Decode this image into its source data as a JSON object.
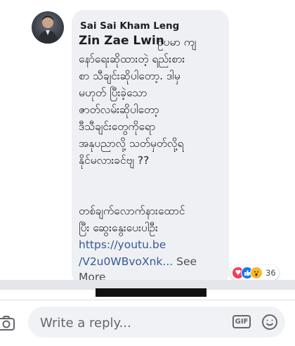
{
  "comment": {
    "author": "Sai Sai Kham Leng",
    "mention": "Zin Zae Lwin",
    "body_lines": [
      "ဥပမာ ကျ",
      "နော်ရေးဆိုထားတဲ့ ရည်းစား",
      "စာ သီချင်းဆိုပါတော့. ဒါမှ",
      "မဟုတ် ပြီးခဲ့သော",
      "ဇာတ်လမ်းဆိုပါတော့",
      "ဒီသီချင်းတွေကိုရော",
      "အနုပညာလို့ သတ်မှတ်လို့ရ",
      "နိုင်မလားခင်ဗျ ??",
      "",
      "တစ်ချက်လောက်နားထောင်",
      "ပြီး ဆွေးနွေးပေးပါဦး"
    ],
    "link_line1": "https://youtu.be",
    "link_line2": "/V2u0WBvoXnk...",
    "see_more_1": " See",
    "see_more_2": "More",
    "reactions": {
      "icons": [
        "love-icon",
        "like-icon",
        "wow-icon"
      ],
      "count": "36"
    }
  },
  "reply": {
    "placeholder": "Write a reply...",
    "gif_label": "GIF"
  },
  "colors": {
    "bubble": "#eef0f3",
    "link": "#385898",
    "love": "#f33e58",
    "like": "#1877f2",
    "wow": "#f7b928"
  }
}
